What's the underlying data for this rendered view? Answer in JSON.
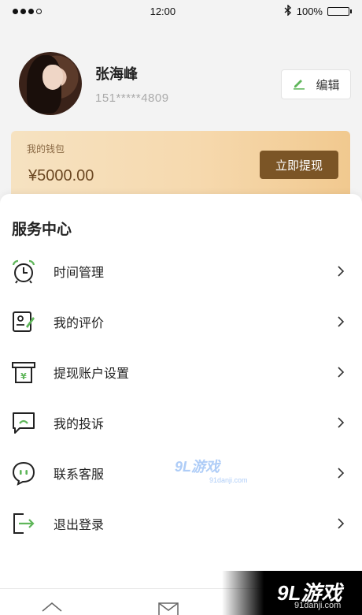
{
  "status_bar": {
    "time": "12:00",
    "battery": "100%"
  },
  "profile": {
    "name": "张海峰",
    "phone": "151*****4809",
    "edit_label": "编辑"
  },
  "wallet": {
    "label": "我的钱包",
    "amount": "¥5000.00",
    "withdraw_label": "立即提现"
  },
  "service": {
    "title": "服务中心",
    "items": [
      {
        "label": "时间管理",
        "icon": "alarm-clock-icon"
      },
      {
        "label": "我的评价",
        "icon": "review-icon"
      },
      {
        "label": "提现账户设置",
        "icon": "withdraw-account-icon"
      },
      {
        "label": "我的投诉",
        "icon": "complaint-icon"
      },
      {
        "label": "联系客服",
        "icon": "customer-service-icon"
      },
      {
        "label": "退出登录",
        "icon": "logout-icon"
      }
    ]
  },
  "watermark": {
    "center_big": "9",
    "center_big_b": "L",
    "center_cn": "游戏",
    "center_small": "91danji.com",
    "corner_big": "9L游戏",
    "corner_small": "91danji.com"
  },
  "colors": {
    "accent_green": "#5fb65a",
    "wallet_button": "#7b5526"
  }
}
